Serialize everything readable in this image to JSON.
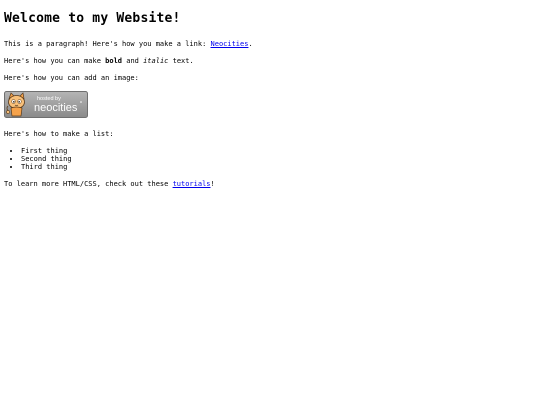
{
  "heading": "Welcome to my Website!",
  "link_paragraph": {
    "before": "This is a paragraph! Here's how you make a link: ",
    "link_text": "Neocities",
    "after": "."
  },
  "format_paragraph": {
    "before": "Here's how you can make ",
    "bold_text": "bold",
    "middle": " and ",
    "italic_text": "italic",
    "after": " text."
  },
  "image_paragraph": "Here's how you can add an image:",
  "badge": {
    "hosted_by": "hosted by",
    "brand": "neocities",
    "colors": {
      "background": "#999999",
      "text": "#ffffff",
      "mascot_fur": "#f5a24b",
      "mascot_outline": "#5a3a1a"
    }
  },
  "list_paragraph": "Here's how to make a list:",
  "list_items": [
    "First thing",
    "Second thing",
    "Third thing"
  ],
  "tutorial_paragraph": {
    "before": "To learn more HTML/CSS, check out these ",
    "link_text": "tutorials",
    "after": "!"
  },
  "colors": {
    "link": "#0000ee",
    "text": "#000000",
    "background": "#ffffff"
  }
}
